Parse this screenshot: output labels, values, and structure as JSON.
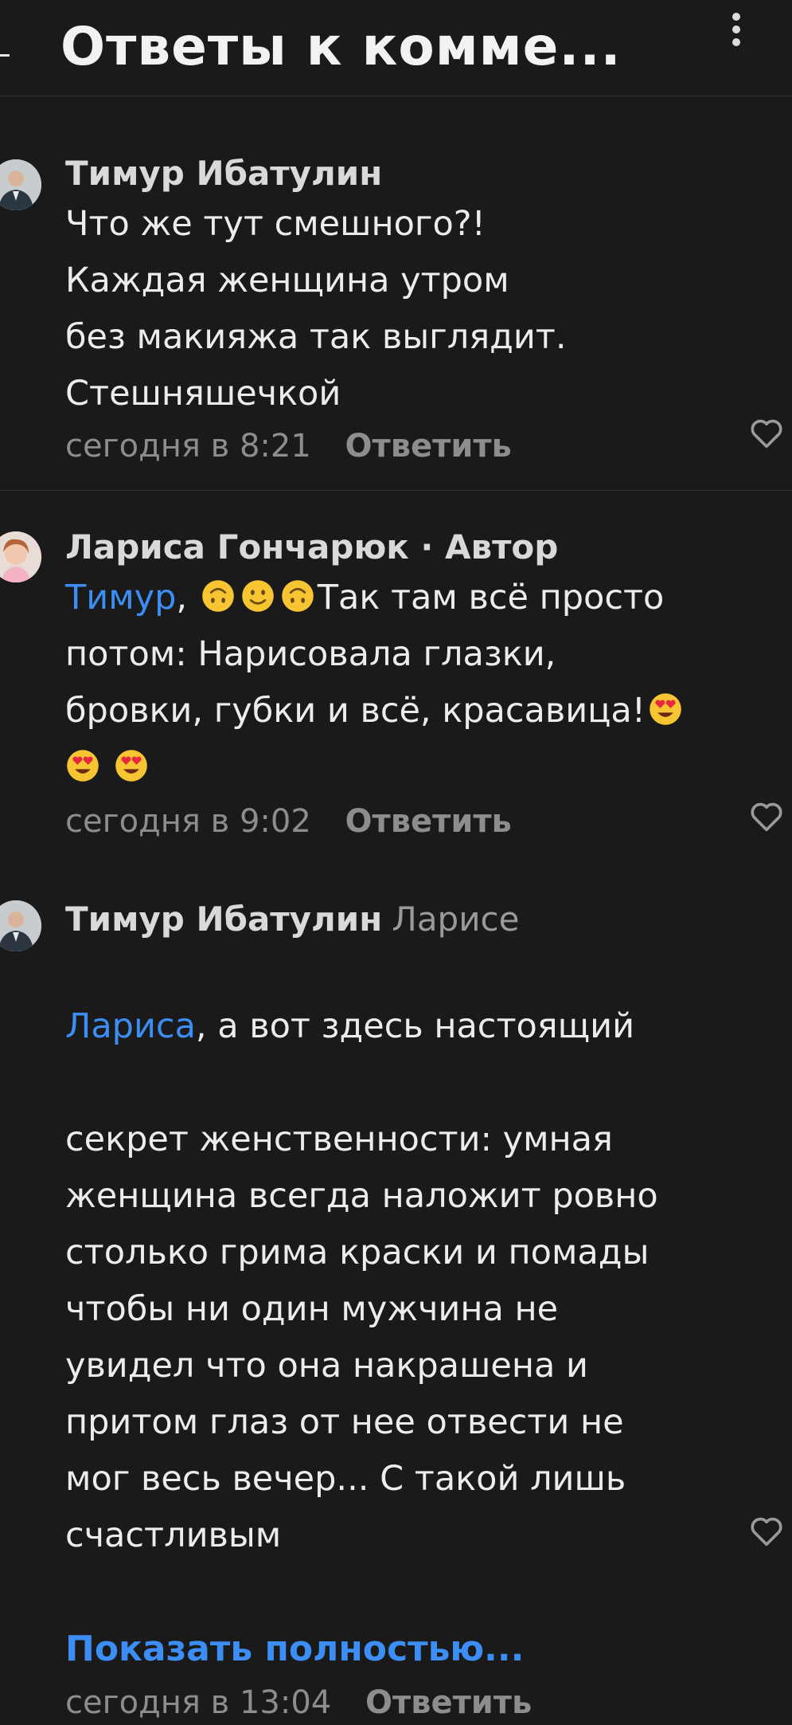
{
  "header": {
    "title": "Ответы к комме..."
  },
  "comments": [
    {
      "author": "Тимур Ибатулин",
      "text": "Что же тут смешного?!\nКаждая женщина утром\nбез макияжа так выглядит.\nСтешняшечкой",
      "time": "сегодня в 8:21",
      "reply_label": "Ответить"
    },
    {
      "author": "Лариса Гончарюк",
      "author_tag": "Автор",
      "mention": "Тимур",
      "text_part1": "Так там всё просто",
      "text_part2": "потом: Нарисовала глазки,",
      "text_part3": "бровки, губки и всё, красавица!",
      "time": "сегодня в 9:02",
      "reply_label": "Ответить"
    },
    {
      "author": "Тимур Ибатулин",
      "reply_to": "Ларисе",
      "mention": "Лариса",
      "text_first": ", а вот здесь настоящий",
      "text_rest": "секрет женственности: умная\nженщина всегда наложит ровно\nстолько грима краски и помады\nчтобы ни один мужчина не\nувидел что она накрашена и\nпритом глаз от нее отвести не\nмог весь вечер... С такой лишь\nсчастливым",
      "show_more": "Показать полностью...",
      "time": "сегодня в 13:04",
      "reply_label": "Ответить"
    }
  ],
  "colors": {
    "background": "#1a1a1b",
    "link": "#3d8ef4",
    "muted": "#8d8d8d"
  }
}
